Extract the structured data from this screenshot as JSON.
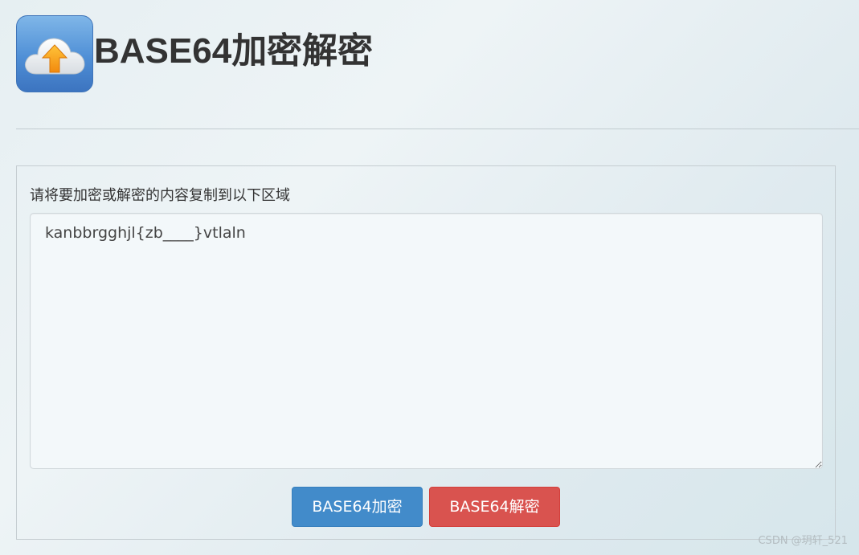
{
  "header": {
    "logo_icon": "cloud-upload-icon",
    "title": "BASE64加密解密"
  },
  "panel": {
    "instruction": "请将要加密或解密的内容复制到以下区域",
    "content_value": "kanbbrgghjl{zb____}vtlaln"
  },
  "buttons": {
    "encode_label": "BASE64加密",
    "decode_label": "BASE64解密"
  },
  "watermark": {
    "text": "CSDN @玥轩_521"
  },
  "colors": {
    "encode_button": "#428bca",
    "decode_button": "#d9534f",
    "logo_blue": "#4f8fd6",
    "arrow_orange": "#f7a21b"
  }
}
